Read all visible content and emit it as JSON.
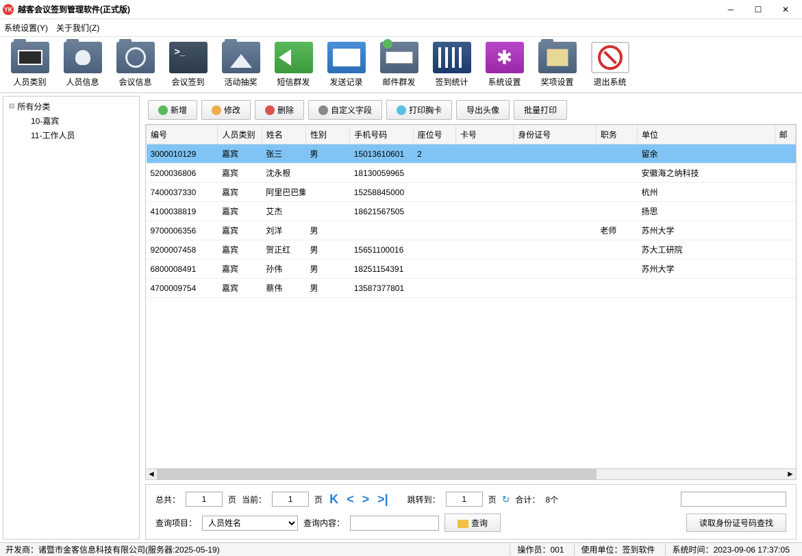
{
  "window": {
    "title": "越客会议签到管理软件(正式版)"
  },
  "menu": {
    "settings": "系统设置(Y)",
    "about": "关于我们(Z)"
  },
  "toolbar": [
    {
      "label": "人员类别"
    },
    {
      "label": "人员信息"
    },
    {
      "label": "会议信息"
    },
    {
      "label": "会议签到"
    },
    {
      "label": "活动抽奖"
    },
    {
      "label": "短信群发"
    },
    {
      "label": "发送记录"
    },
    {
      "label": "邮件群发"
    },
    {
      "label": "签到统计"
    },
    {
      "label": "系统设置"
    },
    {
      "label": "奖项设置"
    },
    {
      "label": "退出系统"
    }
  ],
  "tree": {
    "root": "所有分类",
    "c1": "10-嘉宾",
    "c2": "11-工作人员"
  },
  "actions": {
    "add": "新增",
    "edit": "修改",
    "del": "删除",
    "custom": "自定义字段",
    "print": "打印胸卡",
    "export": "导出头像",
    "batch": "批量打印"
  },
  "columns": {
    "id": "编号",
    "cat": "人员类别",
    "name": "姓名",
    "sex": "性别",
    "phone": "手机号码",
    "seat": "座位号",
    "card": "卡号",
    "idno": "身份证号",
    "job": "职务",
    "unit": "单位",
    "mail": "邮"
  },
  "rows": [
    {
      "id": "3000010129",
      "cat": "嘉宾",
      "name": "张三",
      "sex": "男",
      "phone": "15013610601",
      "seat": "2",
      "card": "",
      "idno": "",
      "job": "",
      "unit": "留余"
    },
    {
      "id": "5200036806",
      "cat": "嘉宾",
      "name": "沈永根",
      "sex": "",
      "phone": "18130059965",
      "seat": "",
      "card": "",
      "idno": "",
      "job": "",
      "unit": "安徽海之纳科技"
    },
    {
      "id": "7400037330",
      "cat": "嘉宾",
      "name": "阿里巴巴集",
      "sex": "",
      "phone": "15258845000",
      "seat": "",
      "card": "",
      "idno": "",
      "job": "",
      "unit": "杭州"
    },
    {
      "id": "4100038819",
      "cat": "嘉宾",
      "name": "艾杰",
      "sex": "",
      "phone": "18621567505",
      "seat": "",
      "card": "",
      "idno": "",
      "job": "",
      "unit": "扬思"
    },
    {
      "id": "9700006356",
      "cat": "嘉宾",
      "name": "刘洋",
      "sex": "男",
      "phone": "",
      "seat": "",
      "card": "",
      "idno": "",
      "job": "老师",
      "unit": "苏州大学"
    },
    {
      "id": "9200007458",
      "cat": "嘉宾",
      "name": "贺正红",
      "sex": "男",
      "phone": "15651100016",
      "seat": "",
      "card": "",
      "idno": "",
      "job": "",
      "unit": "苏大工研院"
    },
    {
      "id": "6800008491",
      "cat": "嘉宾",
      "name": "孙伟",
      "sex": "男",
      "phone": "18251154391",
      "seat": "",
      "card": "",
      "idno": "",
      "job": "",
      "unit": "苏州大学"
    },
    {
      "id": "4700009754",
      "cat": "嘉宾",
      "name": "蔡伟",
      "sex": "男",
      "phone": "13587377801",
      "seat": "",
      "card": "",
      "idno": "",
      "job": "",
      "unit": ""
    }
  ],
  "pager": {
    "total_lbl": "总共：",
    "total_val": "1",
    "page_unit": " 页 ",
    "current_lbl": "当前：",
    "current_val": "1",
    "page_unit2": " 页 ",
    "jump_lbl": "跳转到：",
    "jump_val": "1",
    "page_unit3": " 页 ",
    "sum_lbl": "合计：",
    "sum_val": "8个",
    "query_field_lbl": "查询项目：",
    "query_field_val": "人员姓名",
    "query_content_lbl": "查询内容：",
    "search_btn": "查询",
    "read_id_btn": "读取身份证号码查找"
  },
  "status": {
    "dev_lbl": "开发商：",
    "dev_val": "诸暨市金客信息科技有限公司(服务器:2025-05-19)",
    "op_lbl": "操作员：",
    "op_val": "001",
    "unit_lbl": "使用单位：",
    "unit_val": "签到软件",
    "time_lbl": "系统时间：",
    "time_val": "2023-09-06 17:37:05"
  }
}
